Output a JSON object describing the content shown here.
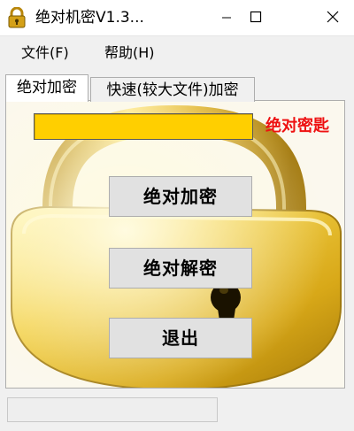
{
  "window": {
    "title": "绝对机密V1.3...",
    "icons": {
      "app": "padlock-icon",
      "minimize": "minimize-icon",
      "maximize": "maximize-icon",
      "close": "close-icon"
    }
  },
  "menu": {
    "items": [
      {
        "label": "文件(F)"
      },
      {
        "label": "帮助(H)"
      }
    ]
  },
  "tabs": [
    {
      "label": "绝对加密",
      "selected": true
    },
    {
      "label": "快速(较大文件)加密",
      "selected": false
    }
  ],
  "main": {
    "key_label": "绝对密匙",
    "key_value": "",
    "buttons": {
      "encrypt": "绝对加密",
      "decrypt": "绝对解密",
      "exit": "退出"
    },
    "background": "golden-padlock-image"
  },
  "colors": {
    "key_field": "#ffcf00",
    "key_label": "#ee1111"
  },
  "status": {
    "text": ""
  }
}
